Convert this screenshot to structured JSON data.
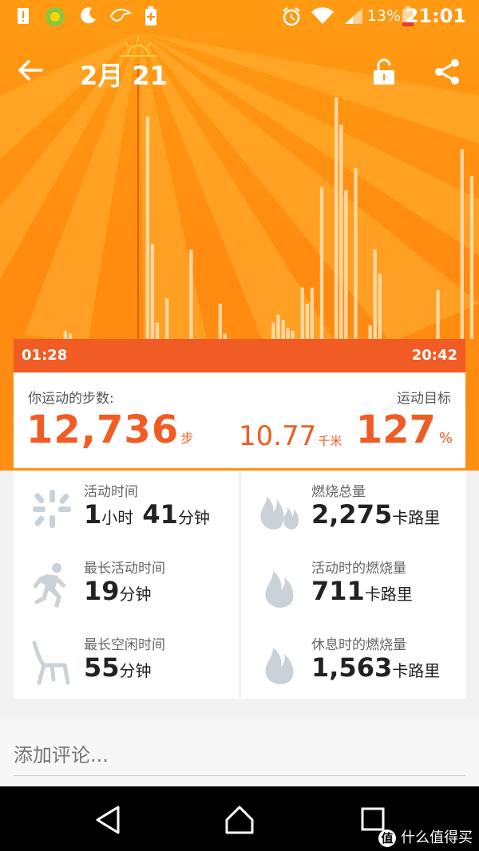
{
  "status_bar": {
    "battery_percent": "13%",
    "time": "21:01"
  },
  "app_bar": {
    "date": "2月 21"
  },
  "timeline": {
    "start": "01:28",
    "end": "20:42"
  },
  "chart_data": {
    "type": "bar",
    "values": [
      0,
      0,
      0,
      0,
      0,
      0,
      0,
      0,
      0,
      0,
      0,
      0,
      0,
      3,
      2,
      0,
      0,
      0,
      0,
      0,
      0,
      0,
      0,
      0,
      0,
      0,
      0,
      0,
      0,
      0,
      82,
      35,
      6,
      0,
      15,
      0,
      0,
      0,
      0,
      33,
      0,
      0,
      0,
      0,
      0,
      13,
      2,
      0,
      0,
      0,
      0,
      0,
      0,
      0,
      0,
      0,
      6,
      9,
      7,
      4,
      3,
      0,
      19,
      13,
      19,
      0,
      56,
      0,
      0,
      89,
      79,
      55,
      0,
      63,
      0,
      0,
      5,
      33,
      24,
      0,
      0,
      0,
      0,
      0,
      0,
      0,
      0,
      0,
      0,
      0,
      18,
      0,
      0,
      0,
      0,
      70,
      0,
      60,
      0
    ],
    "colors": {
      "bar": "#ffd7a0",
      "background": "#ff9412"
    },
    "grid": false,
    "xlabel": "",
    "ylabel": ""
  },
  "steps": {
    "label": "你运动的步数:",
    "value": "12,736",
    "unit": "步"
  },
  "distance": {
    "value": "10.77",
    "unit": "千米"
  },
  "goal": {
    "label": "运动目标",
    "value": "127",
    "unit": "%"
  },
  "stats_left": [
    {
      "label": "活动时间",
      "v1": "1",
      "u1": "小时",
      "v2": " 41",
      "u2": "分钟",
      "icon": "activity-burst-icon"
    },
    {
      "label": "最长活动时间",
      "v1": "19",
      "u1": "分钟",
      "v2": "",
      "u2": "",
      "icon": "runner-icon"
    },
    {
      "label": "最长空闲时间",
      "v1": "55",
      "u1": "分钟",
      "v2": "",
      "u2": "",
      "icon": "chair-icon"
    }
  ],
  "stats_right": [
    {
      "label": "燃烧总量",
      "v1": "2,275",
      "u1": "卡路里",
      "icon": "double-flame-icon"
    },
    {
      "label": "活动时的燃烧量",
      "v1": "711",
      "u1": "卡路里",
      "icon": "flame-icon"
    },
    {
      "label": "休息时的燃烧量",
      "v1": "1,563",
      "u1": "卡路里",
      "icon": "flame-icon"
    }
  ],
  "comment": {
    "placeholder": "添加评论..."
  },
  "watermark": {
    "badge": "值",
    "text": "什么值得买"
  },
  "colors": {
    "accent": "#f05c23",
    "hero_orange": "#ff9412",
    "icon_gray": "#c9d2d8"
  }
}
